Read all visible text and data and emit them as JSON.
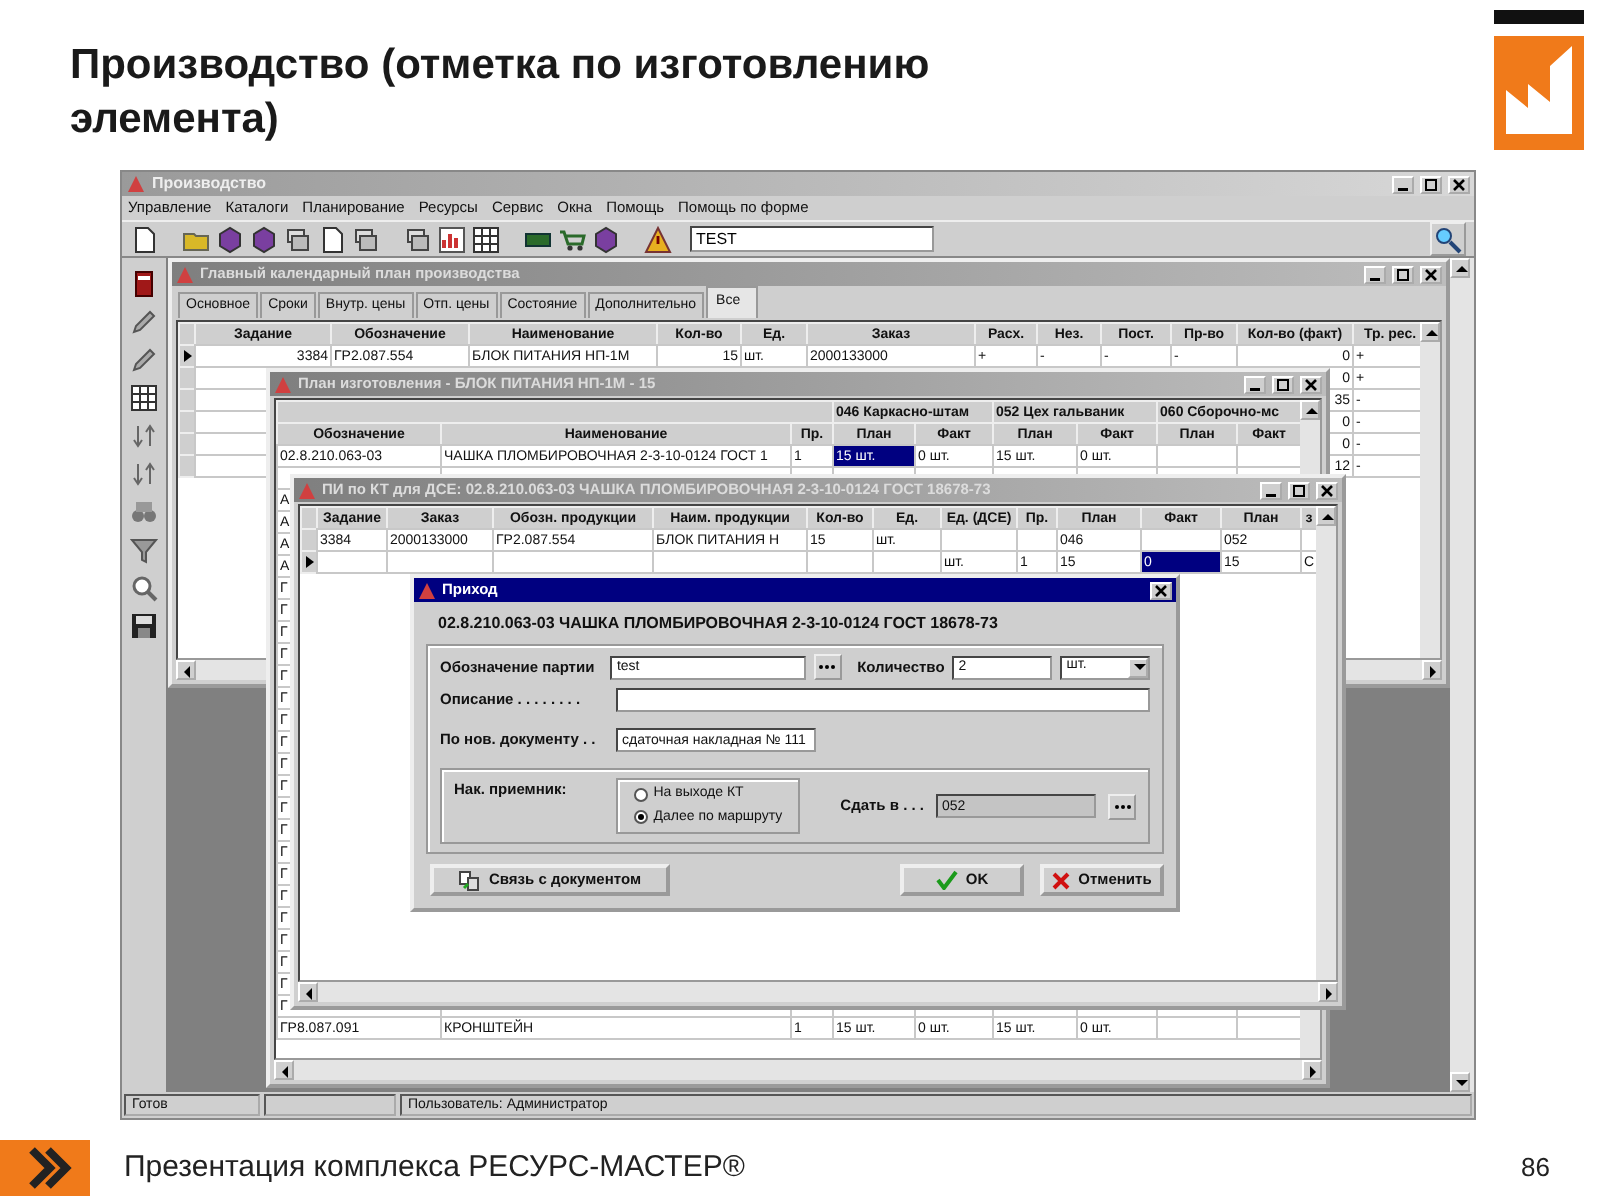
{
  "slide": {
    "title": "Производство (отметка по изготовлению элемента)",
    "footer": "Презентация комплекса РЕСУРС-МАСТЕР®",
    "page_number": "86"
  },
  "app": {
    "title": "Производство",
    "menu": [
      "Управление",
      "Каталоги",
      "Планирование",
      "Ресурсы",
      "Сервис",
      "Окна",
      "Помощь",
      "Помощь по форме"
    ],
    "search": {
      "value": "TEST"
    },
    "status_bar": {
      "state": "Готов",
      "user": "Пользователь: Администратор"
    }
  },
  "windows": [
    {
      "title": "Главный календарный план производства",
      "active": false,
      "tabs": [
        {
          "label": "Основное",
          "selected": false
        },
        {
          "label": "Сроки",
          "selected": false
        },
        {
          "label": "Внутр. цены",
          "selected": false
        },
        {
          "label": "Отп. цены",
          "selected": false
        },
        {
          "label": "Состояние",
          "selected": false
        },
        {
          "label": "Дополнительно",
          "selected": false
        },
        {
          "label": "Все",
          "selected": true
        }
      ],
      "table": {
        "columns": [
          "Задание",
          "Обозначение",
          "Наименование",
          "Кол-во",
          "Ед.",
          "Заказ",
          "Расх.",
          "Нез.",
          "Пост.",
          "Пр-во",
          "Кол-во (факт)",
          "Тр. рес."
        ],
        "rows": [
          {
            "current": true,
            "cells": [
              "3384",
              "ГР2.087.554",
              "БЛОК ПИТАНИЯ НП-1М",
              "15",
              "шт.",
              "2000133000",
              "+",
              "-",
              "-",
              "-",
              "0",
              "+"
            ]
          },
          {
            "current": false,
            "cells": [
              null,
              null,
              null,
              null,
              null,
              null,
              null,
              null,
              null,
              null,
              "0",
              "+"
            ]
          },
          {
            "current": false,
            "cells": [
              null,
              null,
              null,
              null,
              null,
              null,
              null,
              null,
              null,
              null,
              "35",
              "-"
            ]
          },
          {
            "current": false,
            "cells": [
              null,
              null,
              null,
              null,
              null,
              null,
              null,
              null,
              null,
              null,
              "0",
              "-"
            ]
          },
          {
            "current": false,
            "cells": [
              null,
              null,
              null,
              null,
              null,
              null,
              null,
              null,
              null,
              null,
              "0",
              "-"
            ]
          },
          {
            "current": false,
            "cells": [
              null,
              null,
              null,
              null,
              null,
              null,
              null,
              null,
              null,
              null,
              "12",
              "-"
            ]
          }
        ]
      }
    },
    {
      "title": "План изготовления - БЛОК ПИТАНИЯ НП-1М - 15",
      "active": false,
      "table": {
        "column_groups": [
          "046 Каркасно-штам",
          "052 Цех гальваник",
          "060 Сборочно-мс"
        ],
        "columns": [
          "Обозначение",
          "Наименование",
          "Пр.",
          "План",
          "Факт",
          "План",
          "Факт",
          "План",
          "Факт"
        ],
        "rows": [
          {
            "cells": [
              "02.8.210.063-03",
              "ЧАШКА ПЛОМБИРОВОЧНАЯ 2-3-10-0124 ГОСТ 1",
              "1",
              {
                "text": "15 шт.",
                "selected": true
              },
              "0 шт.",
              "15 шт.",
              "0 шт."
            ]
          },
          {
            "cells": []
          },
          {
            "cells": [
              "А"
            ]
          },
          {
            "cells": [
              "А"
            ]
          },
          {
            "cells": [
              "А"
            ]
          },
          {
            "cells": [
              "А"
            ]
          },
          {
            "cells": [
              "Г"
            ]
          },
          {
            "cells": [
              "Г"
            ]
          },
          {
            "cells": [
              "Г"
            ]
          },
          {
            "cells": [
              "Г"
            ]
          },
          {
            "cells": [
              "Г"
            ]
          },
          {
            "cells": [
              "Г"
            ]
          },
          {
            "cells": [
              "Г"
            ]
          },
          {
            "cells": [
              "Г"
            ]
          },
          {
            "cells": [
              "Г"
            ]
          },
          {
            "cells": [
              "Г"
            ]
          },
          {
            "cells": [
              "Г"
            ]
          },
          {
            "cells": [
              "Г"
            ]
          },
          {
            "cells": [
              "Г"
            ]
          },
          {
            "cells": [
              "Г"
            ]
          },
          {
            "cells": [
              "Г"
            ]
          },
          {
            "cells": [
              "Г"
            ]
          },
          {
            "cells": [
              "Г"
            ]
          },
          {
            "cells": [
              "Г"
            ]
          },
          {
            "cells": [
              "Г"
            ]
          },
          {
            "cells": [
              "Г"
            ]
          },
          {
            "cells": [
              "ГР8.087.091",
              "КРОНШТЕЙН",
              "1",
              "15 шт.",
              "0 шт.",
              "15 шт.",
              "0 шт."
            ]
          }
        ]
      }
    },
    {
      "title": "ПИ по КТ для ДСЕ: 02.8.210.063-03 ЧАШКА ПЛОМБИРОВОЧНАЯ 2-3-10-0124 ГОСТ 18678-73",
      "active": false,
      "table": {
        "columns": [
          "Задание",
          "Заказ",
          "Обозн. продукции",
          "Наим. продукции",
          "Кол-во",
          "Ед.",
          "Ед. (ДСЕ)",
          "Пр.",
          "План",
          "Факт",
          "План",
          "з"
        ],
        "rows": [
          {
            "current": false,
            "cells": [
              "3384",
              "2000133000",
              "ГР2.087.554",
              "БЛОК ПИТАНИЯ Н",
              "15",
              "шт.",
              null,
              null,
              "046",
              null,
              "052",
              null
            ]
          },
          {
            "current": true,
            "cells": [
              null,
              null,
              null,
              null,
              null,
              null,
              "шт.",
              "1",
              "15",
              {
                "text": "0",
                "selected": true
              },
              "15",
              "С"
            ]
          }
        ]
      }
    }
  ],
  "dialog": {
    "title": "Приход",
    "active": true,
    "item": "02.8.210.063-03 ЧАШКА ПЛОМБИРОВОЧНАЯ 2-3-10-0124 ГОСТ 18678-73",
    "batch": {
      "label": "Обозначение партии",
      "value": "test"
    },
    "quantity": {
      "label": "Количество",
      "value": "2",
      "unit": "шт."
    },
    "description": {
      "label": "Описание . . . . . . . ."
    },
    "document": {
      "label": "По нов. документу . .",
      "value": "сдаточная накладная № 111"
    },
    "receiver": {
      "label": "Нак. приемник:",
      "options": [
        {
          "label": "На выходе КТ",
          "selected": false
        },
        {
          "label": "Далее по маршруту",
          "selected": true
        }
      ]
    },
    "deliver_to": {
      "label": "Сдать в . . .",
      "value": "052",
      "disabled": true
    },
    "buttons": [
      {
        "kind": "link",
        "label": "Связь с документом"
      },
      {
        "kind": "ok",
        "label": "OK"
      },
      {
        "kind": "cancel",
        "label": "Отменить"
      }
    ]
  }
}
